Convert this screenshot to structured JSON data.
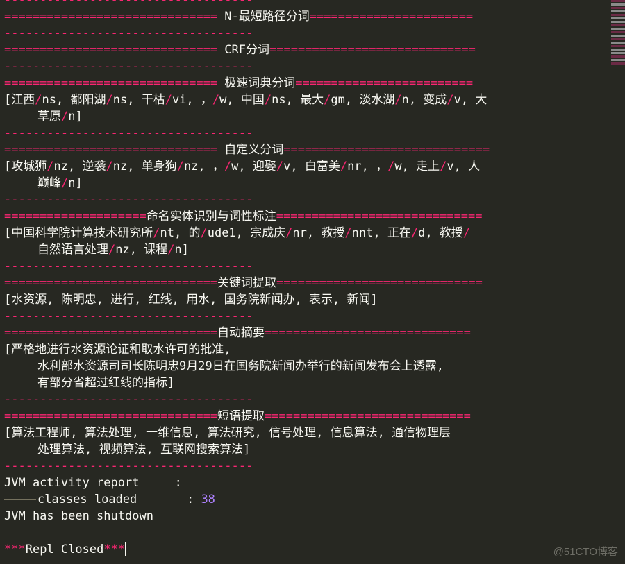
{
  "app": "Sublime Text REPL console",
  "separator_dash": "-----------------------------------",
  "sections": [
    {
      "title": " N-最短路径分词",
      "left_eq": "==============================",
      "right_eq": "=======================",
      "lines": []
    },
    {
      "title": " CRF分词",
      "left_eq": "==============================",
      "right_eq": "=============================",
      "lines": []
    },
    {
      "title": " 极速词典分词",
      "left_eq": "==============================",
      "right_eq": "=========================",
      "tokens": [
        {
          "w": "江西",
          "t": "ns"
        },
        {
          "w": "鄱阳湖",
          "t": "ns"
        },
        {
          "w": "干枯",
          "t": "vi"
        },
        {
          "w": "，",
          "t": "w"
        },
        {
          "w": "中国",
          "t": "ns"
        },
        {
          "w": "最大",
          "t": "gm"
        },
        {
          "w": "淡水湖",
          "t": "n"
        },
        {
          "w": "变成",
          "t": "v"
        },
        {
          "w": "大",
          "t": ""
        }
      ],
      "continuation": [
        {
          "w": "草原",
          "t": "n"
        }
      ]
    },
    {
      "title": " 自定义分词",
      "left_eq": "==============================",
      "right_eq": "=============================",
      "tokens": [
        {
          "w": "攻城狮",
          "t": "nz"
        },
        {
          "w": "逆袭",
          "t": "nz"
        },
        {
          "w": "单身狗",
          "t": "nz"
        },
        {
          "w": "，",
          "t": "w"
        },
        {
          "w": "迎娶",
          "t": "v"
        },
        {
          "w": "白富美",
          "t": "nr"
        },
        {
          "w": "，",
          "t": "w"
        },
        {
          "w": "走上",
          "t": "v"
        },
        {
          "w": "人",
          "t": ""
        }
      ],
      "continuation": [
        {
          "w": "巅峰",
          "t": "n"
        }
      ]
    },
    {
      "title": "命名实体识别与词性标注",
      "left_eq": "====================",
      "right_eq": "=============================",
      "tokens": [
        {
          "w": "中国科学院计算技术研究所",
          "t": "nt"
        },
        {
          "w": "的",
          "t": "ude1"
        },
        {
          "w": "宗成庆",
          "t": "nr"
        },
        {
          "w": "教授",
          "t": "nnt"
        },
        {
          "w": "正在",
          "t": "d"
        },
        {
          "w": "教授",
          "t": "/"
        }
      ],
      "continuation": [
        {
          "w": "自然语言处理",
          "t": "nz"
        },
        {
          "w": "课程",
          "t": "n"
        }
      ]
    },
    {
      "title": "关键词提取",
      "left_eq": "==============================",
      "right_eq": "=============================",
      "plain_line": "[水资源, 陈明忠, 进行, 红线, 用水, 国务院新闻办, 表示, 新闻]"
    },
    {
      "title": "自动摘要",
      "left_eq": "==============================",
      "right_eq": "=============================",
      "plain_line": "[严格地进行水资源论证和取水许可的批准,",
      "plain_continuation": [
        "水利部水资源司司长陈明忠9月29日在国务院新闻办举行的新闻发布会上透露,",
        "有部分省超过红线的指标]"
      ]
    },
    {
      "title": "短语提取",
      "left_eq": "==============================",
      "right_eq": "=============================",
      "plain_line": "[算法工程师, 算法处理, 一维信息, 算法研究, 信号处理, 信息算法, 通信物理层",
      "plain_continuation": [
        "处理算法, 视频算法, 互联网搜索算法]"
      ]
    }
  ],
  "jvm": {
    "report_label": "JVM activity report",
    "report_dots": "     ",
    "report_colon": ":",
    "classes_label": "classes loaded",
    "classes_dots": "       ",
    "classes_colon": ": ",
    "classes_value": "38",
    "shutdown": "JVM has been shutdown"
  },
  "repl_closed": {
    "stars_left": "***",
    "label": "Repl Closed",
    "stars_right": "***"
  },
  "watermark": "@51CTO博客",
  "colors": {
    "background": "#272822",
    "text": "#f8f8f2",
    "accent": "#f92672",
    "number": "#ae81ff"
  }
}
